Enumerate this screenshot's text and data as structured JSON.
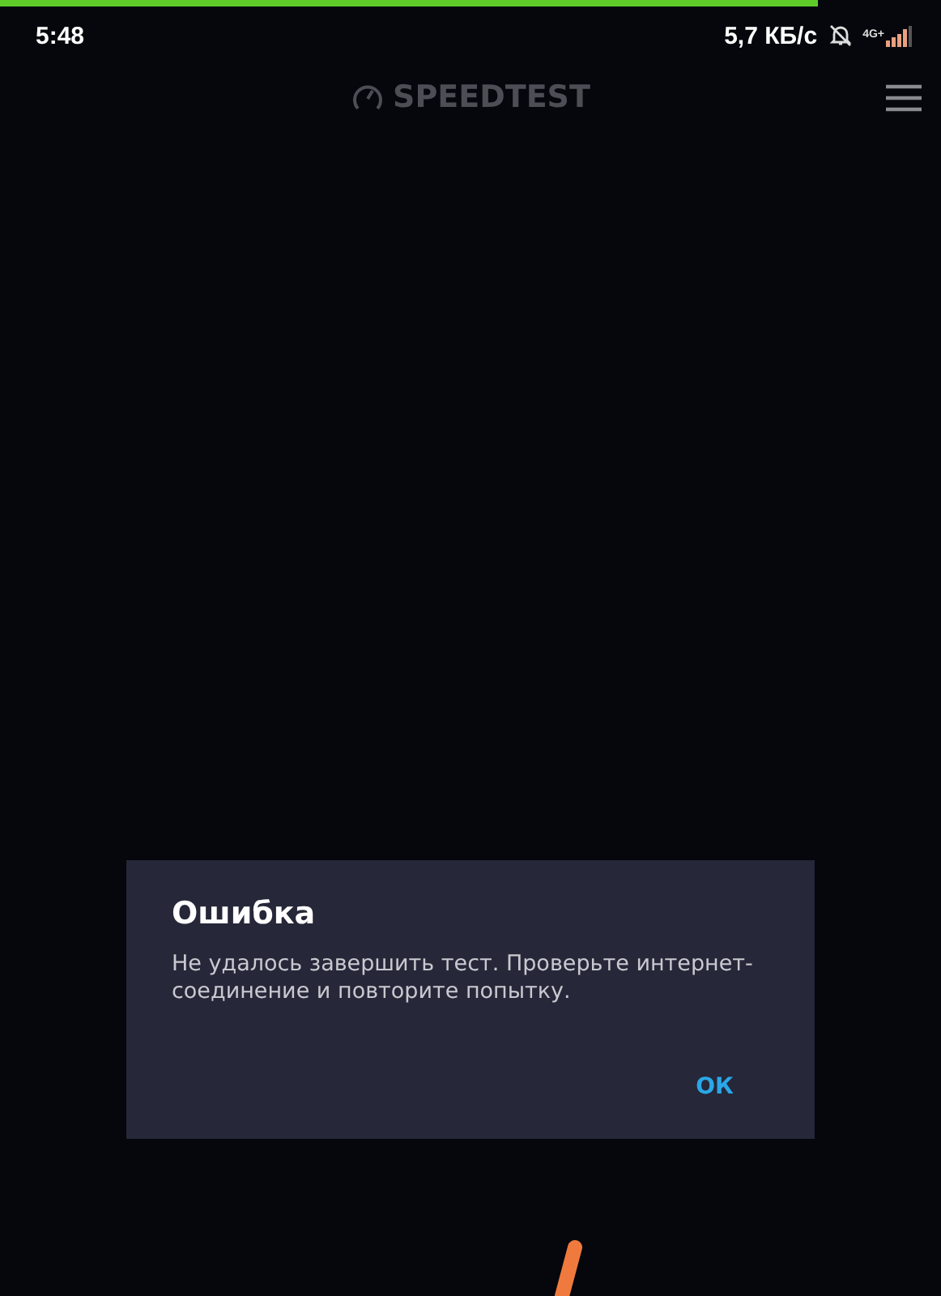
{
  "progress": {
    "level": 0.87
  },
  "status_bar": {
    "time": "5:48",
    "speed": "5,7 КБ/с",
    "network": "4G+"
  },
  "header": {
    "logo": "SPEEDTEST"
  },
  "dialog": {
    "title": "Ошибка",
    "message": "Не удалось завершить тест. Проверьте интернет-соединение и повторите попытку.",
    "buttons": [
      "ОК"
    ]
  }
}
